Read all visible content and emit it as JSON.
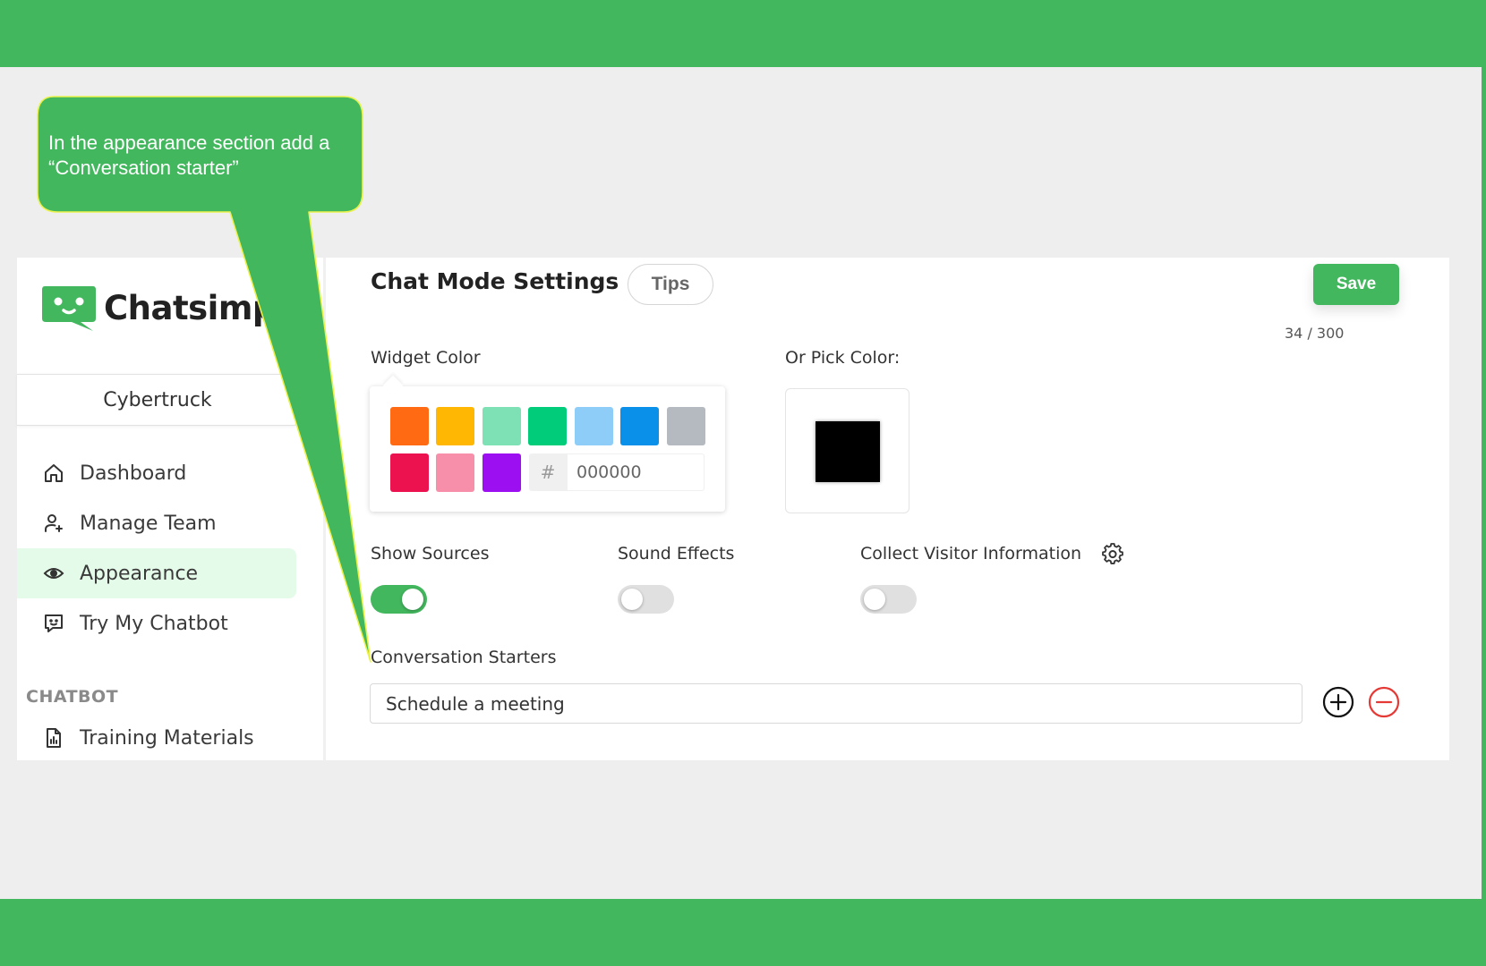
{
  "callout": {
    "text": "In the appearance section add a “Conversation starter”"
  },
  "sidebar": {
    "brand": "Chatsimp",
    "workspace": "Cybertruck",
    "items": [
      {
        "label": "Dashboard",
        "icon": "home-icon"
      },
      {
        "label": "Manage Team",
        "icon": "user-plus-icon"
      },
      {
        "label": "Appearance",
        "icon": "eye-icon",
        "active": true
      },
      {
        "label": "Try My Chatbot",
        "icon": "chat-smile-icon"
      }
    ],
    "section_label": "CHATBOT",
    "section_items": [
      {
        "label": "Training Materials",
        "icon": "document-chart-icon"
      }
    ]
  },
  "header": {
    "title": "Chat Mode Settings",
    "tips_label": "Tips",
    "save_label": "Save",
    "counter": "34 / 300"
  },
  "widget_color": {
    "label": "Widget Color",
    "swatches": [
      "#ff6a13",
      "#ffb703",
      "#7ee0b5",
      "#00cc7a",
      "#8ecdf8",
      "#0a90e8",
      "#b5b9c0",
      "#ec1250",
      "#f78fab",
      "#9b0ff0"
    ],
    "hash_symbol": "#",
    "hex_value": "000000"
  },
  "pick_color": {
    "label": "Or Pick Color:",
    "value": "#000000"
  },
  "toggles": {
    "show_sources": {
      "label": "Show Sources",
      "on": true
    },
    "sound_effects": {
      "label": "Sound Effects",
      "on": false
    },
    "collect_visitor": {
      "label": "Collect Visitor Information",
      "on": false
    }
  },
  "conversation_starters": {
    "label": "Conversation Starters",
    "value": "Schedule a meeting"
  },
  "colors": {
    "brand_green": "#43b75e",
    "active_bg": "#e5fbe9",
    "remove_red": "#e53935"
  }
}
